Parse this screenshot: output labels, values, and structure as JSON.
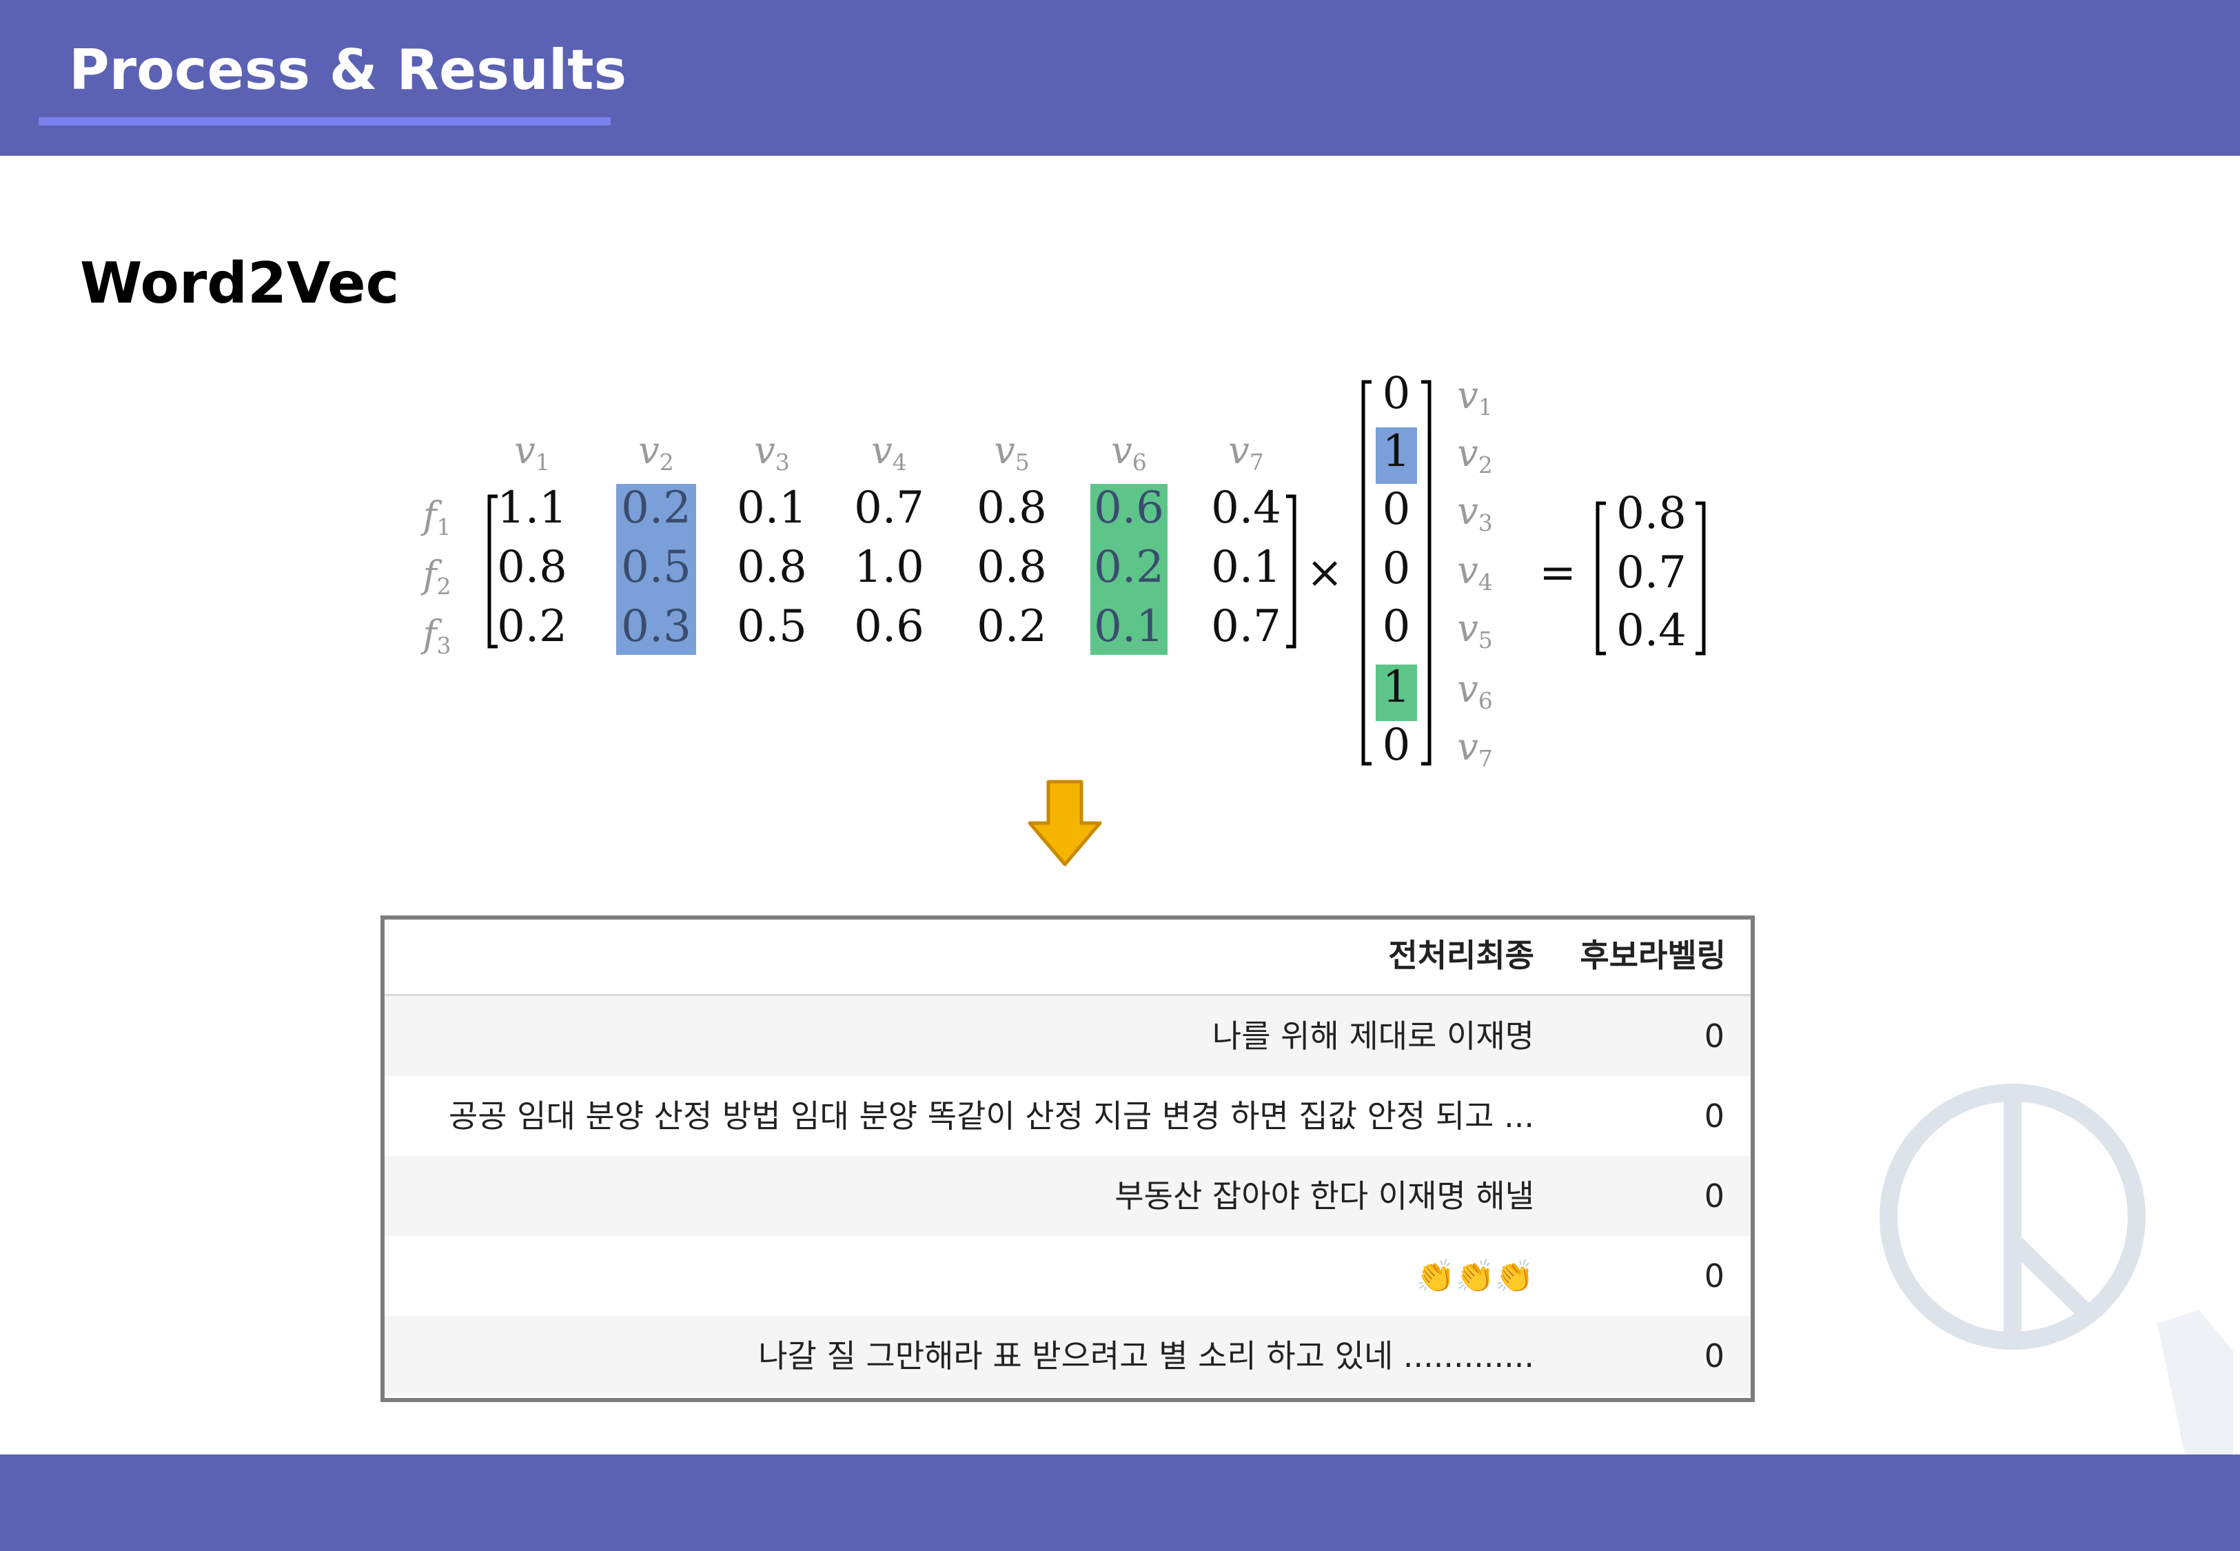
{
  "header": {
    "title": "Process & Results"
  },
  "section": {
    "title": "Word2Vec"
  },
  "equation": {
    "column_labels": [
      "v1",
      "v2",
      "v3",
      "v4",
      "v5",
      "v6",
      "v7"
    ],
    "row_labels": [
      "f1",
      "f2",
      "f3"
    ],
    "matrix": [
      [
        "1.1",
        "0.2",
        "0.1",
        "0.7",
        "0.8",
        "0.6",
        "0.4"
      ],
      [
        "0.8",
        "0.5",
        "0.8",
        "1.0",
        "0.8",
        "0.2",
        "0.1"
      ],
      [
        "0.2",
        "0.3",
        "0.5",
        "0.6",
        "0.2",
        "0.1",
        "0.7"
      ]
    ],
    "highlighted_columns": {
      "v2": "#7b9fd8",
      "v6": "#5ec58a"
    },
    "operator_multiply": "×",
    "operator_equals": "=",
    "vector": [
      "0",
      "1",
      "0",
      "0",
      "0",
      "1",
      "0"
    ],
    "vector_labels": [
      "v1",
      "v2",
      "v3",
      "v4",
      "v5",
      "v6",
      "v7"
    ],
    "result": [
      "0.8",
      "0.7",
      "0.4"
    ]
  },
  "table": {
    "headers": [
      "전처리최종",
      "후보라벨링"
    ],
    "rows": [
      {
        "text": "나를 위해 제대로 이재명",
        "label": "0"
      },
      {
        "text": "공공 임대 분양 산정 방법 임대 분양 똑같이 산정 지금 변경 하면 집값 안정 되고 ...",
        "label": "0"
      },
      {
        "text": "부동산 잡아야 한다 이재명 해낼",
        "label": "0"
      },
      {
        "text": "👏👏👏",
        "label": "0"
      },
      {
        "text": "나갈 질 그만해라 표 받으려고 별 소리 하고 있네 .............",
        "label": "0"
      }
    ]
  },
  "colors": {
    "header_bg": "#5b62b3",
    "accent_underline": "#7a80ee",
    "arrow_fill": "#f5b400",
    "highlight_blue": "#7b9fd8",
    "highlight_green": "#5ec58a"
  },
  "icons": {
    "arrow": "down-arrow-icon",
    "logo": "party-logo-icon"
  }
}
